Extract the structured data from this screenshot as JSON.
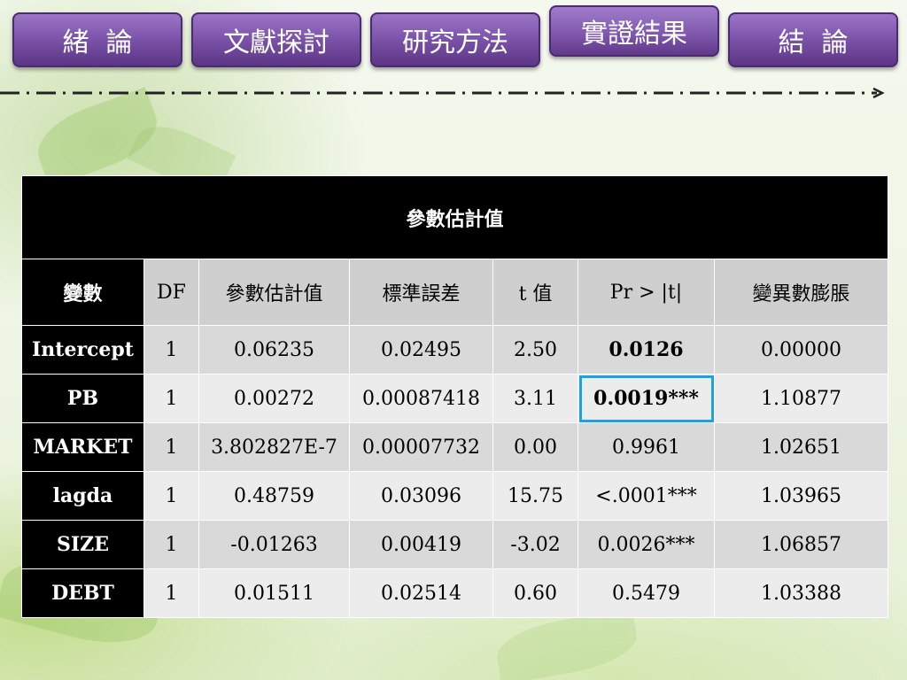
{
  "nav": {
    "items": [
      {
        "label": "緒  論"
      },
      {
        "label": "文獻探討"
      },
      {
        "label": "研究方法"
      },
      {
        "label": "實證結果"
      },
      {
        "label": "結  論"
      }
    ],
    "active_index": 3
  },
  "table": {
    "title": "參數估計值",
    "headers": [
      "變數",
      "DF",
      "參數估計值",
      "標準誤差",
      "t 值",
      "Pr > |t|",
      "變異數膨脹"
    ],
    "rows": [
      {
        "name": "Intercept",
        "df": "1",
        "estimate": "0.06235",
        "stderr": "0.02495",
        "t": "2.50",
        "p": "0.0126",
        "vif": "0.00000"
      },
      {
        "name": "PB",
        "df": "1",
        "estimate": "0.00272",
        "stderr": "0.00087418",
        "t": "3.11",
        "p": "0.0019***",
        "vif": "1.10877"
      },
      {
        "name": "MARKET",
        "df": "1",
        "estimate": "3.802827E-7",
        "stderr": "0.00007732",
        "t": "0.00",
        "p": "0.9961",
        "vif": "1.02651"
      },
      {
        "name": "lagda",
        "df": "1",
        "estimate": "0.48759",
        "stderr": "0.03096",
        "t": "15.75",
        "p": "<.0001***",
        "vif": "1.03965"
      },
      {
        "name": "SIZE",
        "df": "1",
        "estimate": "-0.01263",
        "stderr": "0.00419",
        "t": "-3.02",
        "p": "0.0026***",
        "vif": "1.06857"
      },
      {
        "name": "DEBT",
        "df": "1",
        "estimate": "0.01511",
        "stderr": "0.02514",
        "t": "0.60",
        "p": "0.5479",
        "vif": "1.03388"
      }
    ],
    "highlighted_cell": "PB p-value",
    "colors": {
      "header_dark": "#000000",
      "row_light": "#ececec",
      "row_mid": "#d9d9d9",
      "highlight_border": "#1aa3e0",
      "nav_purple": "#7a52a8"
    }
  }
}
